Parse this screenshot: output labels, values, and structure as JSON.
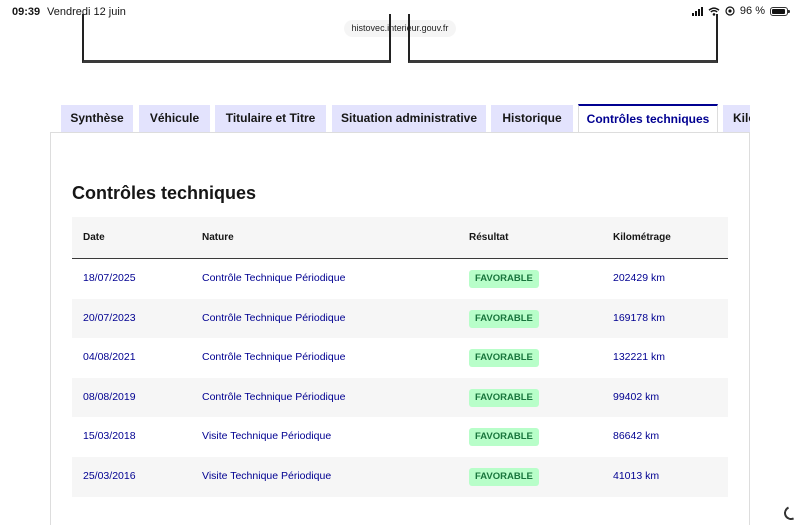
{
  "status_bar": {
    "time": "09:39",
    "date": "Vendredi 12 juin",
    "battery_text": "96 %",
    "battery_level": 0.96,
    "icons": [
      "signal-icon",
      "wifi-icon",
      "location-lock-icon",
      "battery-icon"
    ]
  },
  "browser": {
    "url": "histovec.interieur.gouv.fr"
  },
  "tabs": [
    {
      "label": "Synthèse",
      "active": false
    },
    {
      "label": "Véhicule",
      "active": false
    },
    {
      "label": "Titulaire et Titre",
      "active": false
    },
    {
      "label": "Situation administrative",
      "active": false
    },
    {
      "label": "Historique",
      "active": false
    },
    {
      "label": "Contrôles techniques",
      "active": true
    },
    {
      "label": "Kilo",
      "active": false
    }
  ],
  "section": {
    "title": "Contrôles techniques",
    "columns": [
      "Date",
      "Nature",
      "Résultat",
      "Kilométrage"
    ],
    "rows": [
      {
        "date": "18/07/2025",
        "nature": "Contrôle Technique Périodique",
        "result": "FAVORABLE",
        "km": "202429 km"
      },
      {
        "date": "20/07/2023",
        "nature": "Contrôle Technique Périodique",
        "result": "FAVORABLE",
        "km": "169178 km"
      },
      {
        "date": "04/08/2021",
        "nature": "Contrôle Technique Périodique",
        "result": "FAVORABLE",
        "km": "132221 km"
      },
      {
        "date": "08/08/2019",
        "nature": "Contrôle Technique Périodique",
        "result": "FAVORABLE",
        "km": "99402 km"
      },
      {
        "date": "15/03/2018",
        "nature": "Visite Technique Périodique",
        "result": "FAVORABLE",
        "km": "86642 km"
      },
      {
        "date": "25/03/2016",
        "nature": "Visite Technique Périodique",
        "result": "FAVORABLE",
        "km": "41013 km"
      }
    ]
  },
  "colors": {
    "accent": "#000091",
    "tab_bg": "#e3e3fd",
    "badge_bg": "#b8fec9",
    "badge_text": "#18753c",
    "row_alt": "#f6f6f6"
  }
}
